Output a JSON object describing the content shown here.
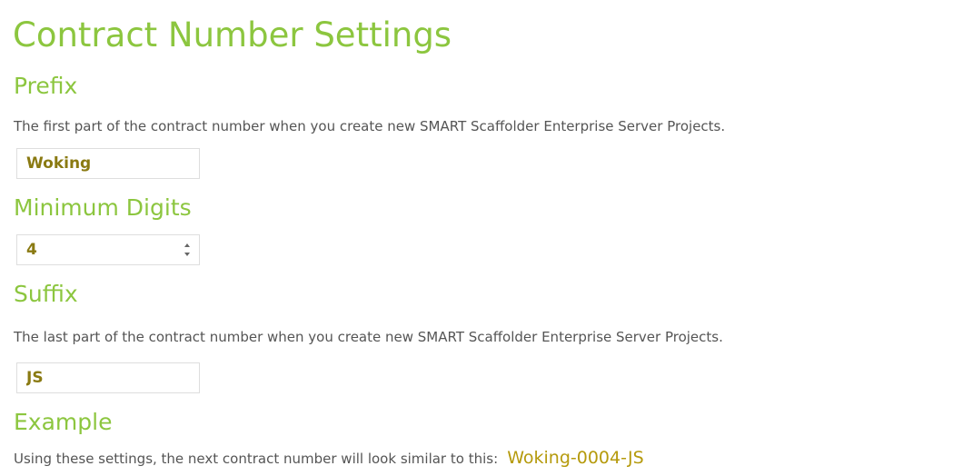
{
  "page": {
    "title": "Contract Number Settings"
  },
  "prefix": {
    "heading": "Prefix",
    "description": "The first part of the contract number when you create new SMART Scaffolder Enterprise Server Projects.",
    "value": "Woking"
  },
  "minimum_digits": {
    "heading": "Minimum Digits",
    "value": "4"
  },
  "suffix": {
    "heading": "Suffix",
    "description": "The last part of the contract number when you create new SMART Scaffolder Enterprise Server Projects.",
    "value": "JS"
  },
  "example": {
    "heading": "Example",
    "description": "Using these settings, the next contract number will look similar to this:",
    "value": "Woking-0004-JS"
  },
  "colors": {
    "heading_green": "#8cc63f",
    "value_olive": "#8a7a12",
    "example_gold": "#b59a0c"
  }
}
